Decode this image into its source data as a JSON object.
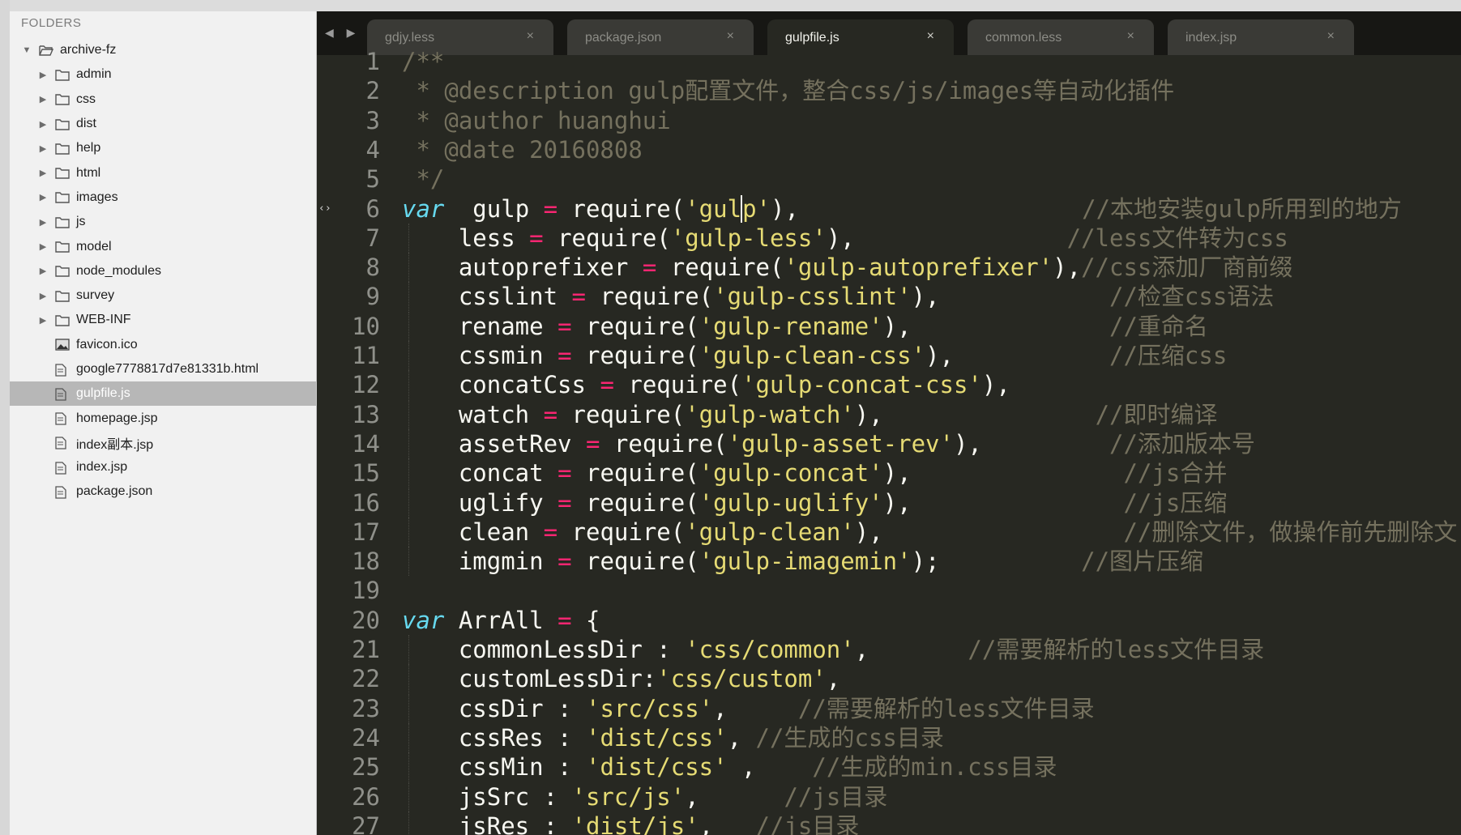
{
  "sidebar": {
    "header": "FOLDERS",
    "items": [
      {
        "label": "archive-fz",
        "type": "folder-open",
        "arrow": "▼",
        "level": 0
      },
      {
        "label": "admin",
        "type": "folder",
        "arrow": "▶",
        "level": 1
      },
      {
        "label": "css",
        "type": "folder",
        "arrow": "▶",
        "level": 1
      },
      {
        "label": "dist",
        "type": "folder",
        "arrow": "▶",
        "level": 1
      },
      {
        "label": "help",
        "type": "folder",
        "arrow": "▶",
        "level": 1
      },
      {
        "label": "html",
        "type": "folder",
        "arrow": "▶",
        "level": 1
      },
      {
        "label": "images",
        "type": "folder",
        "arrow": "▶",
        "level": 1
      },
      {
        "label": "js",
        "type": "folder",
        "arrow": "▶",
        "level": 1
      },
      {
        "label": "model",
        "type": "folder",
        "arrow": "▶",
        "level": 1
      },
      {
        "label": "node_modules",
        "type": "folder",
        "arrow": "▶",
        "level": 1
      },
      {
        "label": "survey",
        "type": "folder",
        "arrow": "▶",
        "level": 1
      },
      {
        "label": "WEB-INF",
        "type": "folder",
        "arrow": "▶",
        "level": 1
      },
      {
        "label": "favicon.ico",
        "type": "image",
        "arrow": "",
        "level": 1
      },
      {
        "label": "google7778817d7e81331b.html",
        "type": "file",
        "arrow": "",
        "level": 1
      },
      {
        "label": "gulpfile.js",
        "type": "file",
        "arrow": "",
        "level": 1,
        "selected": true
      },
      {
        "label": "homepage.jsp",
        "type": "file",
        "arrow": "",
        "level": 1
      },
      {
        "label": "index副本.jsp",
        "type": "file",
        "arrow": "",
        "level": 1
      },
      {
        "label": "index.jsp",
        "type": "file",
        "arrow": "",
        "level": 1
      },
      {
        "label": "package.json",
        "type": "file",
        "arrow": "",
        "level": 1
      }
    ]
  },
  "tabs": {
    "nav_arrows": "◀ ▶",
    "items": [
      {
        "label": "gdjy.less",
        "close": "×",
        "active": false
      },
      {
        "label": "package.json",
        "close": "×",
        "active": false
      },
      {
        "label": "gulpfile.js",
        "close": "×",
        "active": true
      },
      {
        "label": "common.less",
        "close": "×",
        "active": false
      },
      {
        "label": "index.jsp",
        "close": "×",
        "active": false
      }
    ]
  },
  "editor": {
    "first_line_number": 1,
    "lines": [
      [
        [
          "cmt",
          "/**"
        ]
      ],
      [
        [
          "cmt",
          " * @description gulp配置文件，整合css/js/images等自动化插件"
        ]
      ],
      [
        [
          "cmt",
          " * @author huanghui"
        ]
      ],
      [
        [
          "cmt",
          " * @date 20160808"
        ]
      ],
      [
        [
          "cmt",
          " */"
        ]
      ],
      [
        [
          "kw",
          "var"
        ],
        [
          "",
          "  gulp "
        ],
        [
          "op",
          "="
        ],
        [
          "",
          " require("
        ],
        [
          "str",
          "'gul"
        ],
        [
          "cursor",
          ""
        ],
        [
          "str",
          "p'"
        ],
        [
          "",
          "),"
        ],
        [
          "",
          "                    "
        ],
        [
          "cmt",
          "//本地安装gulp所用到的地方"
        ]
      ],
      [
        [
          "",
          "    less "
        ],
        [
          "op",
          "="
        ],
        [
          "",
          " require("
        ],
        [
          "str",
          "'gulp-less'"
        ],
        [
          "",
          "),"
        ],
        [
          "",
          "               "
        ],
        [
          "cmt",
          "//less文件转为css"
        ]
      ],
      [
        [
          "",
          "    autoprefixer "
        ],
        [
          "op",
          "="
        ],
        [
          "",
          " require("
        ],
        [
          "str",
          "'gulp-autoprefixer'"
        ],
        [
          "",
          "),"
        ],
        [
          "cmt",
          "//css添加厂商前缀"
        ]
      ],
      [
        [
          "",
          "    csslint "
        ],
        [
          "op",
          "="
        ],
        [
          "",
          " require("
        ],
        [
          "str",
          "'gulp-csslint'"
        ],
        [
          "",
          "),"
        ],
        [
          "",
          "            "
        ],
        [
          "cmt",
          "//检查css语法"
        ]
      ],
      [
        [
          "",
          "    rename "
        ],
        [
          "op",
          "="
        ],
        [
          "",
          " require("
        ],
        [
          "str",
          "'gulp-rename'"
        ],
        [
          "",
          "),"
        ],
        [
          "",
          "              "
        ],
        [
          "cmt",
          "//重命名"
        ]
      ],
      [
        [
          "",
          "    cssmin "
        ],
        [
          "op",
          "="
        ],
        [
          "",
          " require("
        ],
        [
          "str",
          "'gulp-clean-css'"
        ],
        [
          "",
          "),"
        ],
        [
          "",
          "           "
        ],
        [
          "cmt",
          "//压缩css"
        ]
      ],
      [
        [
          "",
          "    concatCss "
        ],
        [
          "op",
          "="
        ],
        [
          "",
          " require("
        ],
        [
          "str",
          "'gulp-concat-css'"
        ],
        [
          "",
          "),"
        ]
      ],
      [
        [
          "",
          "    watch "
        ],
        [
          "op",
          "="
        ],
        [
          "",
          " require("
        ],
        [
          "str",
          "'gulp-watch'"
        ],
        [
          "",
          "),"
        ],
        [
          "",
          "               "
        ],
        [
          "cmt",
          "//即时编译"
        ]
      ],
      [
        [
          "",
          "    assetRev "
        ],
        [
          "op",
          "="
        ],
        [
          "",
          " require("
        ],
        [
          "str",
          "'gulp-asset-rev'"
        ],
        [
          "",
          "),"
        ],
        [
          "",
          "         "
        ],
        [
          "cmt",
          "//添加版本号"
        ]
      ],
      [
        [
          "",
          "    concat "
        ],
        [
          "op",
          "="
        ],
        [
          "",
          " require("
        ],
        [
          "str",
          "'gulp-concat'"
        ],
        [
          "",
          "),"
        ],
        [
          "",
          "               "
        ],
        [
          "cmt",
          "//js合并"
        ]
      ],
      [
        [
          "",
          "    uglify "
        ],
        [
          "op",
          "="
        ],
        [
          "",
          " require("
        ],
        [
          "str",
          "'gulp-uglify'"
        ],
        [
          "",
          "),"
        ],
        [
          "",
          "               "
        ],
        [
          "cmt",
          "//js压缩"
        ]
      ],
      [
        [
          "",
          "    clean "
        ],
        [
          "op",
          "="
        ],
        [
          "",
          " require("
        ],
        [
          "str",
          "'gulp-clean'"
        ],
        [
          "",
          "),"
        ],
        [
          "",
          "                 "
        ],
        [
          "cmt",
          "//删除文件，做操作前先删除文"
        ]
      ],
      [
        [
          "",
          "    imgmin "
        ],
        [
          "op",
          "="
        ],
        [
          "",
          " require("
        ],
        [
          "str",
          "'gulp-imagemin'"
        ],
        [
          "",
          ");"
        ],
        [
          "",
          "          "
        ],
        [
          "cmt",
          "//图片压缩"
        ]
      ],
      [
        [
          "",
          ""
        ]
      ],
      [
        [
          "kw",
          "var"
        ],
        [
          "",
          " ArrAll "
        ],
        [
          "op",
          "="
        ],
        [
          "",
          " {"
        ]
      ],
      [
        [
          "",
          "    commonLessDir : "
        ],
        [
          "str",
          "'css/common'"
        ],
        [
          "",
          ","
        ],
        [
          "",
          "       "
        ],
        [
          "cmt",
          "//需要解析的less文件目录"
        ]
      ],
      [
        [
          "",
          "    customLessDir:"
        ],
        [
          "str",
          "'css/custom'"
        ],
        [
          "",
          ","
        ]
      ],
      [
        [
          "",
          "    cssDir : "
        ],
        [
          "str",
          "'src/css'"
        ],
        [
          "",
          ","
        ],
        [
          "",
          "     "
        ],
        [
          "cmt",
          "//需要解析的less文件目录"
        ]
      ],
      [
        [
          "",
          "    cssRes : "
        ],
        [
          "str",
          "'dist/css'"
        ],
        [
          "",
          ","
        ],
        [
          "",
          " "
        ],
        [
          "cmt",
          "//生成的css目录"
        ]
      ],
      [
        [
          "",
          "    cssMin : "
        ],
        [
          "str",
          "'dist/css'"
        ],
        [
          "",
          " ,"
        ],
        [
          "",
          "    "
        ],
        [
          "cmt",
          "//生成的min.css目录"
        ]
      ],
      [
        [
          "",
          "    jsSrc : "
        ],
        [
          "str",
          "'src/js'"
        ],
        [
          "",
          ","
        ],
        [
          "",
          "      "
        ],
        [
          "cmt",
          "//js目录"
        ]
      ],
      [
        [
          "",
          "    jsRes : "
        ],
        [
          "str",
          "'dist/js'"
        ],
        [
          "",
          ","
        ],
        [
          "",
          "   "
        ],
        [
          "cmt",
          "//js目录"
        ]
      ]
    ],
    "gutter_mark_line": 6,
    "gutter_mark": "‹›"
  },
  "colors": {
    "editor_bg": "#272822",
    "keyword": "#66d9ef",
    "operator": "#f92672",
    "string": "#e6db74",
    "comment": "#75715e",
    "text": "#f8f8f2"
  }
}
